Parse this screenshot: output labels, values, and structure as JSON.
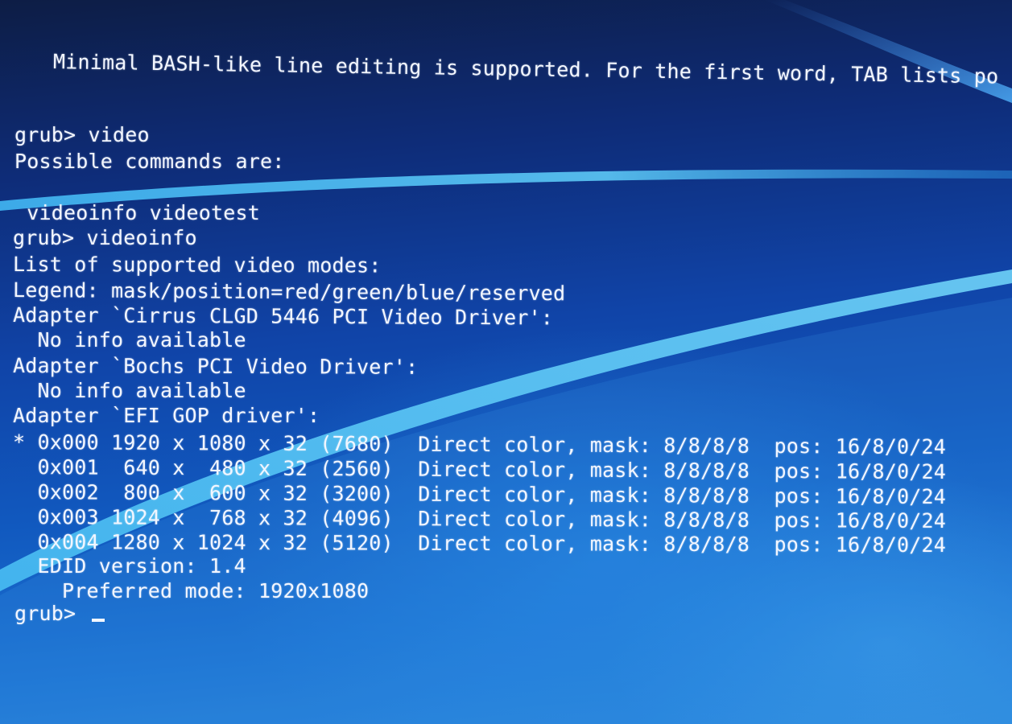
{
  "screen": {
    "background_color": "#1048a8",
    "text_color": "#f2f6ff",
    "accent_streak_color": "#4fc0f0"
  },
  "lines": {
    "intro": "Minimal BASH-like line editing is supported. For the first word, TAB lists po",
    "cmd1": "grub> video",
    "possible": "Possible commands are:",
    "completions": " videoinfo videotest",
    "cmd2": "grub> videoinfo",
    "list_header": "List of supported video modes:",
    "legend": "Legend: mask/position=red/green/blue/reserved",
    "adapter1": "Adapter `Cirrus CLGD 5446 PCI Video Driver':",
    "adapter1_info": "  No info available",
    "adapter2": "Adapter `Bochs PCI Video Driver':",
    "adapter2_info": "  No info available",
    "adapter3": "Adapter `EFI GOP driver':",
    "edid": "  EDID version: 1.4",
    "preferred": "    Preferred mode: 1920x1080",
    "prompt": "grub> "
  },
  "modes": [
    {
      "text": "* 0x000 1920 x 1080 x 32 (7680)  Direct color, mask: 8/8/8/8  pos: 16/8/0/24"
    },
    {
      "text": "  0x001  640 x  480 x 32 (2560)  Direct color, mask: 8/8/8/8  pos: 16/8/0/24"
    },
    {
      "text": "  0x002  800 x  600 x 32 (3200)  Direct color, mask: 8/8/8/8  pos: 16/8/0/24"
    },
    {
      "text": "  0x003 1024 x  768 x 32 (4096)  Direct color, mask: 8/8/8/8  pos: 16/8/0/24"
    },
    {
      "text": "  0x004 1280 x 1024 x 32 (5120)  Direct color, mask: 8/8/8/8  pos: 16/8/0/24"
    }
  ]
}
